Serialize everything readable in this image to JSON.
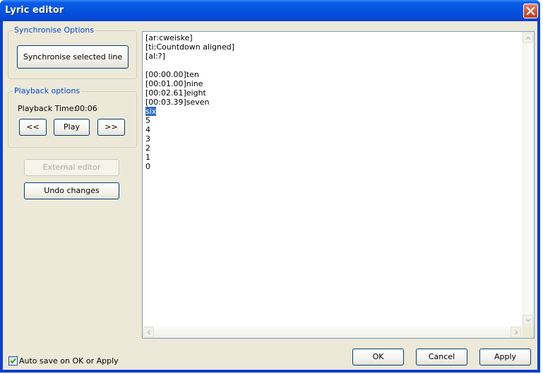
{
  "window": {
    "title": "Lyric editor",
    "close_icon": "close-icon"
  },
  "sync_group": {
    "legend": "Synchronise Options",
    "sync_button": "Synchronise selected line"
  },
  "playback_group": {
    "legend": "Playback options",
    "time_label": "Playback Time:",
    "time_value": "00:06",
    "rewind_button": "<<",
    "play_button": "Play",
    "forward_button": ">>"
  },
  "actions": {
    "external_editor": "External editor",
    "undo_changes": "Undo changes"
  },
  "editor": {
    "lines": [
      "[ar:cweiske]",
      "[ti:Countdown aligned]",
      "[al:?]",
      "",
      "[00:00.00]ten",
      "[00:01.00]nine",
      "[00:02.61]eight",
      "[00:03.39]seven",
      "six",
      "5",
      "4",
      "3",
      "2",
      "1",
      "0"
    ],
    "selected_line_index": 8
  },
  "footer": {
    "autosave_label": "Auto save on OK or Apply",
    "autosave_checked": true,
    "ok": "OK",
    "cancel": "Cancel",
    "apply": "Apply"
  }
}
